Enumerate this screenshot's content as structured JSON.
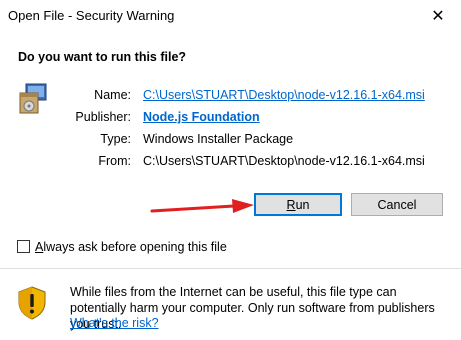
{
  "window": {
    "title": "Open File - Security Warning",
    "close_glyph": "✕"
  },
  "question": "Do you want to run this file?",
  "file_info": {
    "name_label": "Name:",
    "name_value": "C:\\Users\\STUART\\Desktop\\node-v12.16.1-x64.msi",
    "publisher_label": "Publisher:",
    "publisher_value": "Node.js Foundation",
    "type_label": "Type:",
    "type_value": "Windows Installer Package",
    "from_label": "From:",
    "from_value": "C:\\Users\\STUART\\Desktop\\node-v12.16.1-x64.msi"
  },
  "buttons": {
    "run_label_ul": "R",
    "run_label_rest": "un",
    "cancel_label": "Cancel"
  },
  "checkbox": {
    "checked": false,
    "label_ul": "A",
    "label_rest": "lways ask before opening this file"
  },
  "warning": {
    "text": "While files from the Internet can be useful, this file type can potentially harm your computer. Only run software from publishers you trust.",
    "link": "What's the risk?"
  },
  "icons": {
    "package": "installer-package-icon",
    "shield": "security-shield-icon",
    "arrow": "red-arrow-annotation"
  },
  "colors": {
    "link": "#0066cc",
    "focus_border": "#0078d7",
    "arrow": "#e02020"
  }
}
